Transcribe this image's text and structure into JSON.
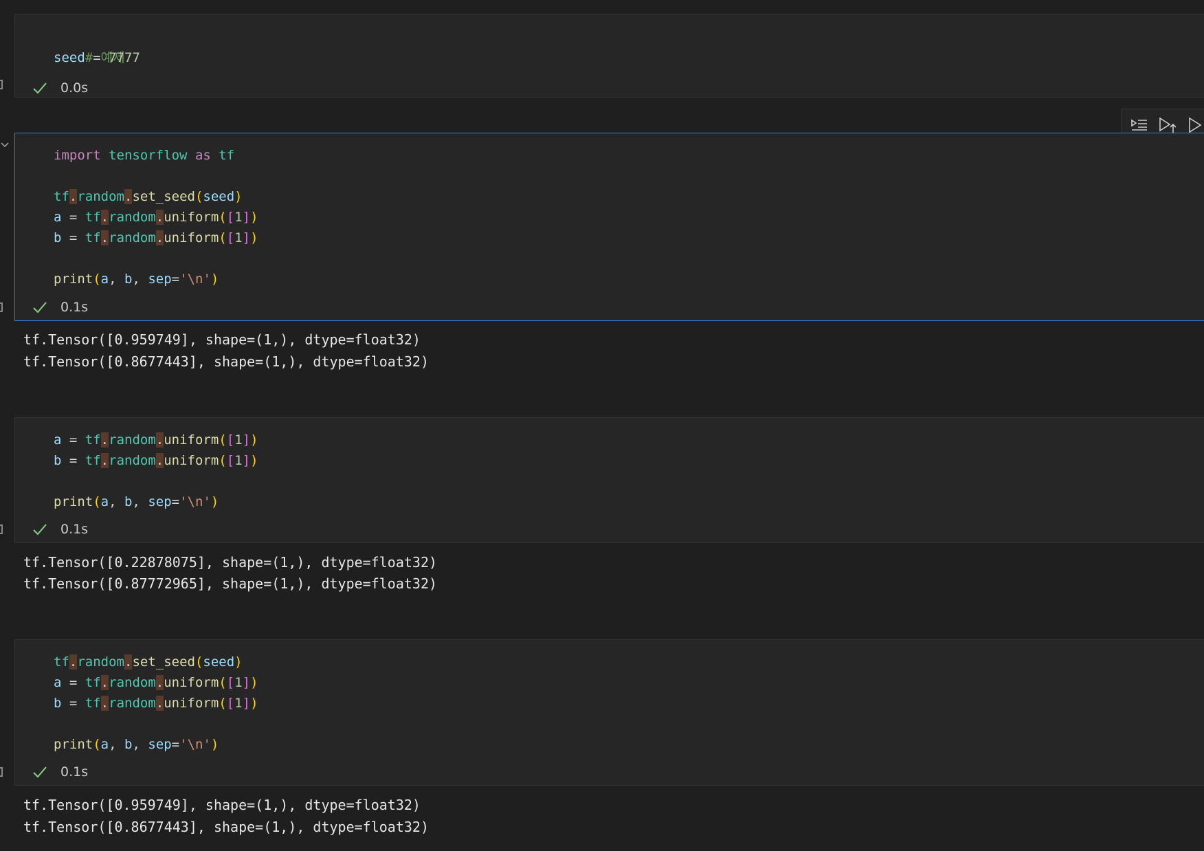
{
  "cells": [
    {
      "code": [
        "# 예제",
        "seed = 7777"
      ],
      "time": "0.0s",
      "output": []
    },
    {
      "code": [
        "import tensorflow as tf",
        "",
        "tf.random.set_seed(seed)",
        "a = tf.random.uniform([1])",
        "b = tf.random.uniform([1])",
        "",
        "print(a, b, sep='\\n')"
      ],
      "time": "0.1s",
      "output": [
        "tf.Tensor([0.959749], shape=(1,), dtype=float32)",
        "tf.Tensor([0.8677443], shape=(1,), dtype=float32)"
      ]
    },
    {
      "code": [
        "a = tf.random.uniform([1])",
        "b = tf.random.uniform([1])",
        "",
        "print(a, b, sep='\\n')"
      ],
      "time": "0.1s",
      "output": [
        "tf.Tensor([0.22878075], shape=(1,), dtype=float32)",
        "tf.Tensor([0.87772965], shape=(1,), dtype=float32)"
      ]
    },
    {
      "code": [
        "tf.random.set_seed(seed)",
        "a = tf.random.uniform([1])",
        "b = tf.random.uniform([1])",
        "",
        "print(a, b, sep='\\n')"
      ],
      "time": "0.1s",
      "output": [
        "tf.Tensor([0.959749], shape=(1,), dtype=float32)",
        "tf.Tensor([0.8677443], shape=(1,), dtype=float32)"
      ]
    }
  ],
  "toolbar": {
    "icons": [
      "execute-above-icon",
      "run-and-move-up-icon",
      "run-cell-icon"
    ]
  },
  "colors": {
    "focus_border": "#3a7bd5",
    "success_check": "#89d185"
  }
}
